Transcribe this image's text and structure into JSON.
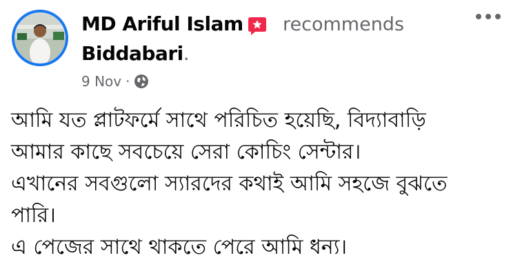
{
  "post": {
    "author": "MD Ariful Islam",
    "action": "recommends",
    "page_name": "Biddabari",
    "page_suffix": ".",
    "date": "9 Nov",
    "separator": "·",
    "audience_icon": "globe-icon",
    "more_icon": "more-horizontal-icon",
    "recommend_icon": "recommend-badge-icon",
    "body_lines": [
      "আমি যত প্লাটফর্মে সাথে পরিচিত হয়েছি, বিদ্যাবাড়ি",
      "আমার কাছে সবচেয়ে সেরা কোচিং সেন্টার।",
      "এখানের সবগুলো স্যারদের কথাই আমি সহজে বুঝতে",
      "পারি।",
      "এ পেজের সাথে থাকতে পেরে আমি ধন্য।"
    ]
  },
  "colors": {
    "accent": "#1877f2",
    "recommend_red": "#f02849",
    "secondary_text": "#65676b"
  }
}
